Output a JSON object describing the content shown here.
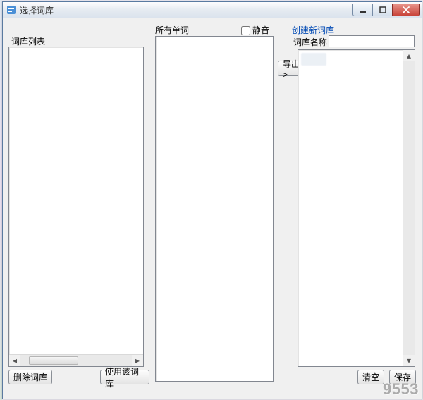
{
  "window": {
    "title": "选择词库"
  },
  "labels": {
    "wordlist": "词库列表",
    "all_words": "所有单词",
    "mute": "静音",
    "create_new": "创建新词库",
    "store_name": "词库名称"
  },
  "inputs": {
    "store_name_value": ""
  },
  "checkbox": {
    "mute_checked": false
  },
  "buttons": {
    "export": "导出>",
    "delete_store": "删除词库",
    "use_store": "使用该词库",
    "clear": "清空",
    "save": "保存"
  },
  "watermark": "9553",
  "colors": {
    "link": "#0049b4"
  }
}
